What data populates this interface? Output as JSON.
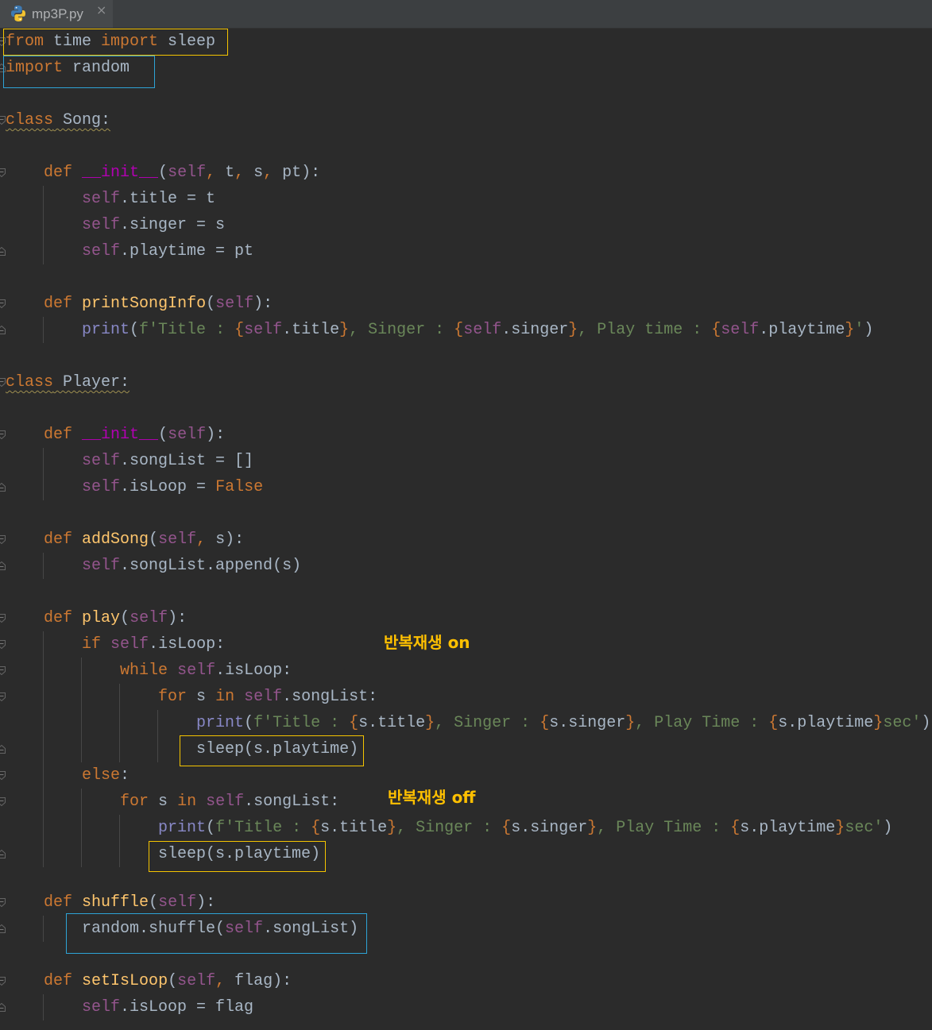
{
  "tab_bar": {
    "tabs": [
      {
        "label": "mp3P.py",
        "icon": "python-file-icon",
        "close_glyph": "×"
      }
    ]
  },
  "colors": {
    "editor_background": "#2b2b2b",
    "default_text": "#a9b7c6",
    "indent_guide": "#474747",
    "weak_warning_underline": "#9e8f50",
    "annotation_yellow": "#f5c400",
    "annotation_label": "#ffc000",
    "annotation_blue": "#2ea3d6"
  },
  "annotations": {
    "loop_on_label": "반복재생 on",
    "loop_off_label": "반복재생 off"
  },
  "editor": {
    "lines": [
      {
        "gutter_icon": "fold-start-icon",
        "tokens": [
          [
            "from",
            "#cc7832"
          ],
          [
            " time "
          ],
          [
            "import",
            "#cc7832"
          ],
          [
            " sleep"
          ]
        ]
      },
      {
        "gutter_icon": "fold-end-icon",
        "tokens": [
          [
            "import",
            "#cc7832"
          ],
          [
            " random"
          ]
        ]
      },
      {
        "tokens": []
      },
      {
        "gutter_icon": "fold-start-icon",
        "weak_warning": true,
        "tokens": [
          [
            "class",
            "#cc7832"
          ],
          [
            " Song:"
          ]
        ]
      },
      {
        "tokens": []
      },
      {
        "gutter_icon": "fold-start-icon",
        "tokens": [
          [
            "    "
          ],
          [
            "def",
            "#cc7832"
          ],
          [
            " "
          ],
          [
            "__init__",
            "#b200b2"
          ],
          [
            "("
          ],
          [
            "self",
            "#94558d"
          ],
          [
            ", ",
            "#cc7832"
          ],
          [
            "t"
          ],
          [
            ", ",
            "#cc7832"
          ],
          [
            "s"
          ],
          [
            ", ",
            "#cc7832"
          ],
          [
            "pt):"
          ]
        ]
      },
      {
        "tokens": [
          [
            "        "
          ],
          [
            "self",
            "#94558d"
          ],
          [
            ".title = t"
          ]
        ]
      },
      {
        "tokens": [
          [
            "        "
          ],
          [
            "self",
            "#94558d"
          ],
          [
            ".singer = s"
          ]
        ]
      },
      {
        "gutter_icon": "fold-end-icon",
        "tokens": [
          [
            "        "
          ],
          [
            "self",
            "#94558d"
          ],
          [
            ".playtime = pt"
          ]
        ]
      },
      {
        "tokens": []
      },
      {
        "gutter_icon": "fold-start-icon",
        "tokens": [
          [
            "    "
          ],
          [
            "def",
            "#cc7832"
          ],
          [
            " "
          ],
          [
            "printSongInfo",
            "#ffc66d"
          ],
          [
            "("
          ],
          [
            "self",
            "#94558d"
          ],
          [
            "):"
          ]
        ]
      },
      {
        "gutter_icon": "fold-end-icon",
        "tokens": [
          [
            "        "
          ],
          [
            "print",
            "#8888c6"
          ],
          [
            "("
          ],
          [
            "f'Title : ",
            "#6a8759"
          ],
          [
            "{",
            "#cc7832"
          ],
          [
            "self",
            "#94558d"
          ],
          [
            ".title"
          ],
          [
            "}",
            "#cc7832"
          ],
          [
            ", Singer : ",
            "#6a8759"
          ],
          [
            "{",
            "#cc7832"
          ],
          [
            "self",
            "#94558d"
          ],
          [
            ".singer"
          ],
          [
            "}",
            "#cc7832"
          ],
          [
            ", Play time : ",
            "#6a8759"
          ],
          [
            "{",
            "#cc7832"
          ],
          [
            "self",
            "#94558d"
          ],
          [
            ".playtime"
          ],
          [
            "}",
            "#cc7832"
          ],
          [
            "'",
            "#6a8759"
          ],
          [
            ")"
          ]
        ]
      },
      {
        "tokens": []
      },
      {
        "gutter_icon": "fold-start-icon",
        "weak_warning": true,
        "tokens": [
          [
            "class",
            "#cc7832"
          ],
          [
            " Player:"
          ]
        ]
      },
      {
        "tokens": []
      },
      {
        "gutter_icon": "fold-start-icon",
        "tokens": [
          [
            "    "
          ],
          [
            "def",
            "#cc7832"
          ],
          [
            " "
          ],
          [
            "__init__",
            "#b200b2"
          ],
          [
            "("
          ],
          [
            "self",
            "#94558d"
          ],
          [
            "):"
          ]
        ]
      },
      {
        "tokens": [
          [
            "        "
          ],
          [
            "self",
            "#94558d"
          ],
          [
            ".songList = []"
          ]
        ]
      },
      {
        "gutter_icon": "fold-end-icon",
        "tokens": [
          [
            "        "
          ],
          [
            "self",
            "#94558d"
          ],
          [
            ".isLoop = "
          ],
          [
            "False",
            "#cc7832"
          ]
        ]
      },
      {
        "tokens": []
      },
      {
        "gutter_icon": "fold-start-icon",
        "tokens": [
          [
            "    "
          ],
          [
            "def",
            "#cc7832"
          ],
          [
            " "
          ],
          [
            "addSong",
            "#ffc66d"
          ],
          [
            "("
          ],
          [
            "self",
            "#94558d"
          ],
          [
            ", ",
            "#cc7832"
          ],
          [
            "s):"
          ]
        ]
      },
      {
        "gutter_icon": "fold-end-icon",
        "tokens": [
          [
            "        "
          ],
          [
            "self",
            "#94558d"
          ],
          [
            ".songList.append(s)"
          ]
        ]
      },
      {
        "tokens": []
      },
      {
        "gutter_icon": "fold-start-icon",
        "tokens": [
          [
            "    "
          ],
          [
            "def",
            "#cc7832"
          ],
          [
            " "
          ],
          [
            "play",
            "#ffc66d"
          ],
          [
            "("
          ],
          [
            "self",
            "#94558d"
          ],
          [
            "):"
          ]
        ]
      },
      {
        "gutter_icon": "fold-start-icon",
        "tokens": [
          [
            "        "
          ],
          [
            "if",
            "#cc7832"
          ],
          [
            " "
          ],
          [
            "self",
            "#94558d"
          ],
          [
            ".isLoop:"
          ]
        ]
      },
      {
        "gutter_icon": "fold-start-icon",
        "tokens": [
          [
            "            "
          ],
          [
            "while",
            "#cc7832"
          ],
          [
            " "
          ],
          [
            "self",
            "#94558d"
          ],
          [
            ".isLoop:"
          ]
        ]
      },
      {
        "gutter_icon": "fold-start-icon",
        "tokens": [
          [
            "                "
          ],
          [
            "for",
            "#cc7832"
          ],
          [
            " s "
          ],
          [
            "in",
            "#cc7832"
          ],
          [
            " "
          ],
          [
            "self",
            "#94558d"
          ],
          [
            ".songList:"
          ]
        ]
      },
      {
        "tokens": [
          [
            "                    "
          ],
          [
            "print",
            "#8888c6"
          ],
          [
            "("
          ],
          [
            "f'Title : ",
            "#6a8759"
          ],
          [
            "{",
            "#cc7832"
          ],
          [
            "s.title"
          ],
          [
            "}",
            "#cc7832"
          ],
          [
            ", Singer : ",
            "#6a8759"
          ],
          [
            "{",
            "#cc7832"
          ],
          [
            "s.singer"
          ],
          [
            "}",
            "#cc7832"
          ],
          [
            ", Play Time : ",
            "#6a8759"
          ],
          [
            "{",
            "#cc7832"
          ],
          [
            "s.playtime"
          ],
          [
            "}",
            "#cc7832"
          ],
          [
            "sec'",
            "#6a8759"
          ],
          [
            ")"
          ]
        ]
      },
      {
        "gutter_icon": "fold-end-icon",
        "tokens": [
          [
            "                    "
          ],
          [
            "sleep(s.playtime)"
          ]
        ]
      },
      {
        "gutter_icon": "fold-start-icon",
        "tokens": [
          [
            "        "
          ],
          [
            "else",
            "#cc7832"
          ],
          [
            ":"
          ]
        ]
      },
      {
        "gutter_icon": "fold-start-icon",
        "tokens": [
          [
            "            "
          ],
          [
            "for",
            "#cc7832"
          ],
          [
            " s "
          ],
          [
            "in",
            "#cc7832"
          ],
          [
            " "
          ],
          [
            "self",
            "#94558d"
          ],
          [
            ".songList:"
          ]
        ]
      },
      {
        "tokens": [
          [
            "                "
          ],
          [
            "print",
            "#8888c6"
          ],
          [
            "("
          ],
          [
            "f'Title : ",
            "#6a8759"
          ],
          [
            "{",
            "#cc7832"
          ],
          [
            "s.title"
          ],
          [
            "}",
            "#cc7832"
          ],
          [
            ", Singer : ",
            "#6a8759"
          ],
          [
            "{",
            "#cc7832"
          ],
          [
            "s.singer"
          ],
          [
            "}",
            "#cc7832"
          ],
          [
            ", Play Time : ",
            "#6a8759"
          ],
          [
            "{",
            "#cc7832"
          ],
          [
            "s.playtime"
          ],
          [
            "}",
            "#cc7832"
          ],
          [
            "sec'",
            "#6a8759"
          ],
          [
            ")"
          ]
        ]
      },
      {
        "gutter_icon": "fold-end-icon",
        "tokens": [
          [
            "                "
          ],
          [
            "sleep(s.playtime)"
          ]
        ]
      },
      {
        "tokens": []
      },
      {
        "gutter_icon": "fold-start-icon",
        "tokens": [
          [
            "    "
          ],
          [
            "def",
            "#cc7832"
          ],
          [
            " "
          ],
          [
            "shuffle",
            "#ffc66d"
          ],
          [
            "("
          ],
          [
            "self",
            "#94558d"
          ],
          [
            "):"
          ]
        ]
      },
      {
        "gutter_icon": "fold-end-icon",
        "tokens": [
          [
            "        "
          ],
          [
            "random.shuffle("
          ],
          [
            "self",
            "#94558d"
          ],
          [
            ".songList)"
          ]
        ]
      },
      {
        "tokens": []
      },
      {
        "gutter_icon": "fold-start-icon",
        "tokens": [
          [
            "    "
          ],
          [
            "def",
            "#cc7832"
          ],
          [
            " "
          ],
          [
            "setIsLoop",
            "#ffc66d"
          ],
          [
            "("
          ],
          [
            "self",
            "#94558d"
          ],
          [
            ", ",
            "#cc7832"
          ],
          [
            "flag):"
          ]
        ]
      },
      {
        "gutter_icon": "fold-end-icon",
        "tokens": [
          [
            "        "
          ],
          [
            "self",
            "#94558d"
          ],
          [
            ".isLoop = flag"
          ]
        ]
      }
    ]
  }
}
